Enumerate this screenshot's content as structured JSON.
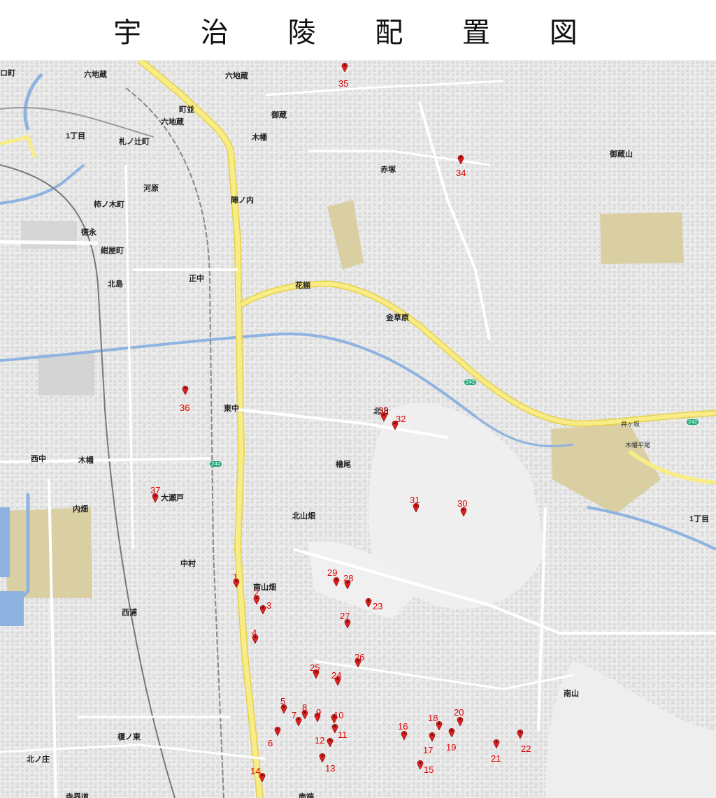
{
  "title": "宇 治 陵 配 置 図",
  "places": [
    {
      "id": "rokujizo",
      "label": "六地蔵"
    },
    {
      "id": "rokujizo2",
      "label": "六地蔵"
    },
    {
      "id": "machinami",
      "label": "町並"
    },
    {
      "id": "rokujizo_st",
      "label": "六地蔵"
    },
    {
      "id": "godzo",
      "label": "御蔵"
    },
    {
      "id": "kowata",
      "label": "木幡"
    },
    {
      "id": "akatsuka",
      "label": "赤塚"
    },
    {
      "id": "gozosan",
      "label": "御蔵山"
    },
    {
      "id": "funanoki",
      "label": "札ノ辻町"
    },
    {
      "id": "kawara",
      "label": "河原"
    },
    {
      "id": "kakinoki",
      "label": "柿ノ木町"
    },
    {
      "id": "tokunou",
      "label": "徳永"
    },
    {
      "id": "konyamachi",
      "label": "紺屋町"
    },
    {
      "id": "kitajima",
      "label": "北島"
    },
    {
      "id": "jinnouchi",
      "label": "陣ノ内"
    },
    {
      "id": "shonaka",
      "label": "正中"
    },
    {
      "id": "hanano",
      "label": "花揃"
    },
    {
      "id": "kinkabara",
      "label": "金草原"
    },
    {
      "id": "higashinaka",
      "label": "東中"
    },
    {
      "id": "kitayama",
      "label": "北山"
    },
    {
      "id": "hiwao",
      "label": "檜尾"
    },
    {
      "id": "kohata",
      "label": "木幡"
    },
    {
      "id": "kitayamahata",
      "label": "北山畑"
    },
    {
      "id": "nishinaka",
      "label": "西中"
    },
    {
      "id": "uchihata",
      "label": "内畑"
    },
    {
      "id": "oose",
      "label": "大瀬戸"
    },
    {
      "id": "nakamura",
      "label": "中村"
    },
    {
      "id": "minamiyamahata",
      "label": "南山畑"
    },
    {
      "id": "nishiura",
      "label": "西浦"
    },
    {
      "id": "minamiyama",
      "label": "南山"
    },
    {
      "id": "enoki",
      "label": "榎ノ東"
    },
    {
      "id": "kitanosho",
      "label": "北ノ庄"
    },
    {
      "id": "teraikai",
      "label": "寺界道"
    },
    {
      "id": "minamibata",
      "label": "南端"
    },
    {
      "id": "itchome",
      "label": "1丁目"
    },
    {
      "id": "itchome2",
      "label": "1丁目"
    },
    {
      "id": "ibusaka",
      "label": "井ヶ坂"
    },
    {
      "id": "kohatahigashi",
      "label": "木幡平尾"
    },
    {
      "id": "lomachi",
      "label": "ロ町"
    }
  ],
  "markers": [
    {
      "id": "1",
      "label": "1"
    },
    {
      "id": "2",
      "label": "2"
    },
    {
      "id": "3",
      "label": "3"
    },
    {
      "id": "4",
      "label": "4"
    },
    {
      "id": "5",
      "label": "5"
    },
    {
      "id": "6",
      "label": "6"
    },
    {
      "id": "7",
      "label": "7"
    },
    {
      "id": "8",
      "label": "8"
    },
    {
      "id": "9",
      "label": "9"
    },
    {
      "id": "10",
      "label": "10"
    },
    {
      "id": "11",
      "label": "11"
    },
    {
      "id": "12",
      "label": "12"
    },
    {
      "id": "13",
      "label": "13"
    },
    {
      "id": "14",
      "label": "14"
    },
    {
      "id": "15",
      "label": "15"
    },
    {
      "id": "16",
      "label": "16"
    },
    {
      "id": "17",
      "label": "17"
    },
    {
      "id": "18",
      "label": "18"
    },
    {
      "id": "19",
      "label": "19"
    },
    {
      "id": "20",
      "label": "20"
    },
    {
      "id": "21",
      "label": "21"
    },
    {
      "id": "22",
      "label": "22"
    },
    {
      "id": "23",
      "label": "23"
    },
    {
      "id": "24",
      "label": "24"
    },
    {
      "id": "25",
      "label": "25"
    },
    {
      "id": "26",
      "label": "26"
    },
    {
      "id": "27",
      "label": "27"
    },
    {
      "id": "28",
      "label": "28"
    },
    {
      "id": "29",
      "label": "29"
    },
    {
      "id": "30",
      "label": "30"
    },
    {
      "id": "31",
      "label": "31"
    },
    {
      "id": "32",
      "label": "32"
    },
    {
      "id": "33",
      "label": "33"
    },
    {
      "id": "34",
      "label": "34"
    },
    {
      "id": "35",
      "label": "35"
    },
    {
      "id": "36",
      "label": "36"
    },
    {
      "id": "37",
      "label": "37"
    }
  ],
  "route_labels": {
    "r242": "242"
  },
  "colors": {
    "marker": "#e02020",
    "marker_label": "#e00000",
    "major_road": "#f5e66a",
    "river": "#8fb3e0",
    "school": "#d9cfa3"
  }
}
